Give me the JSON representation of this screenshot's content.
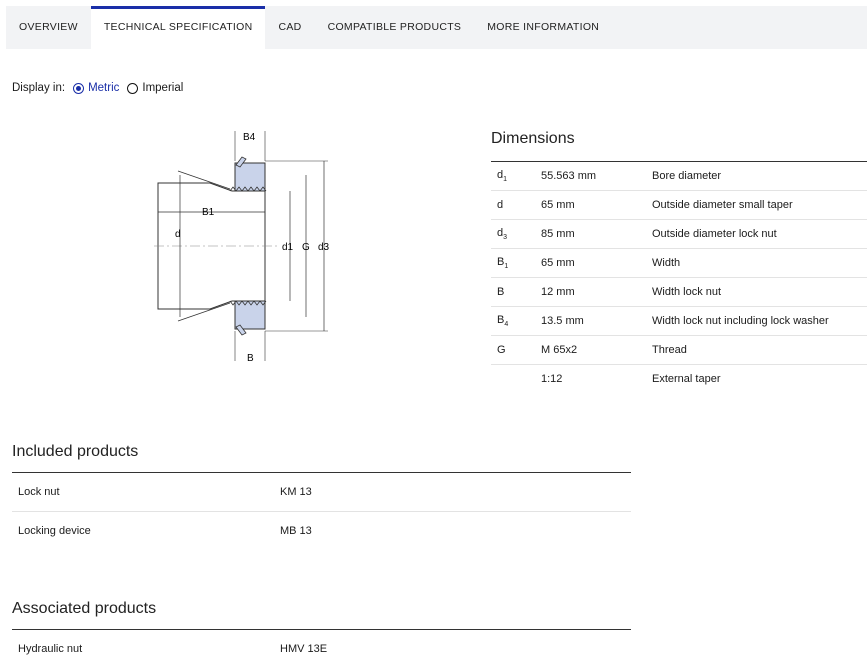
{
  "tabs": [
    "OVERVIEW",
    "TECHNICAL SPECIFICATION",
    "CAD",
    "COMPATIBLE PRODUCTS",
    "MORE INFORMATION"
  ],
  "active_tab": "TECHNICAL SPECIFICATION",
  "display": {
    "label": "Display in:",
    "options": [
      "Metric",
      "Imperial"
    ],
    "selected": "Metric"
  },
  "diagram": {
    "labels": [
      "B4",
      "B1",
      "d",
      "d1",
      "G",
      "d3",
      "B"
    ]
  },
  "dimensions": {
    "title": "Dimensions",
    "rows": [
      {
        "sym": "d",
        "sub": "1",
        "value": "55.563 mm",
        "desc": "Bore diameter"
      },
      {
        "sym": "d",
        "sub": "",
        "value": "65 mm",
        "desc": "Outside diameter small taper"
      },
      {
        "sym": "d",
        "sub": "3",
        "value": "85 mm",
        "desc": "Outside diameter lock nut"
      },
      {
        "sym": "B",
        "sub": "1",
        "value": "65 mm",
        "desc": "Width"
      },
      {
        "sym": "B",
        "sub": "",
        "value": "12 mm",
        "desc": "Width lock nut"
      },
      {
        "sym": "B",
        "sub": "4",
        "value": "13.5 mm",
        "desc": "Width lock nut including lock washer"
      },
      {
        "sym": "G",
        "sub": "",
        "value": "M 65x2",
        "desc": "Thread"
      },
      {
        "sym": "",
        "sub": "",
        "value": "1:12",
        "desc": "External taper"
      }
    ]
  },
  "included": {
    "title": "Included products",
    "rows": [
      {
        "name": "Lock nut",
        "value": "KM 13"
      },
      {
        "name": "Locking device",
        "value": "MB 13"
      }
    ]
  },
  "associated": {
    "title": "Associated products",
    "rows": [
      {
        "name": "Hydraulic nut",
        "value": "HMV 13E"
      }
    ]
  },
  "colors": {
    "accent": "#1a2fa8",
    "nut_fill": "#c9d3ea"
  }
}
